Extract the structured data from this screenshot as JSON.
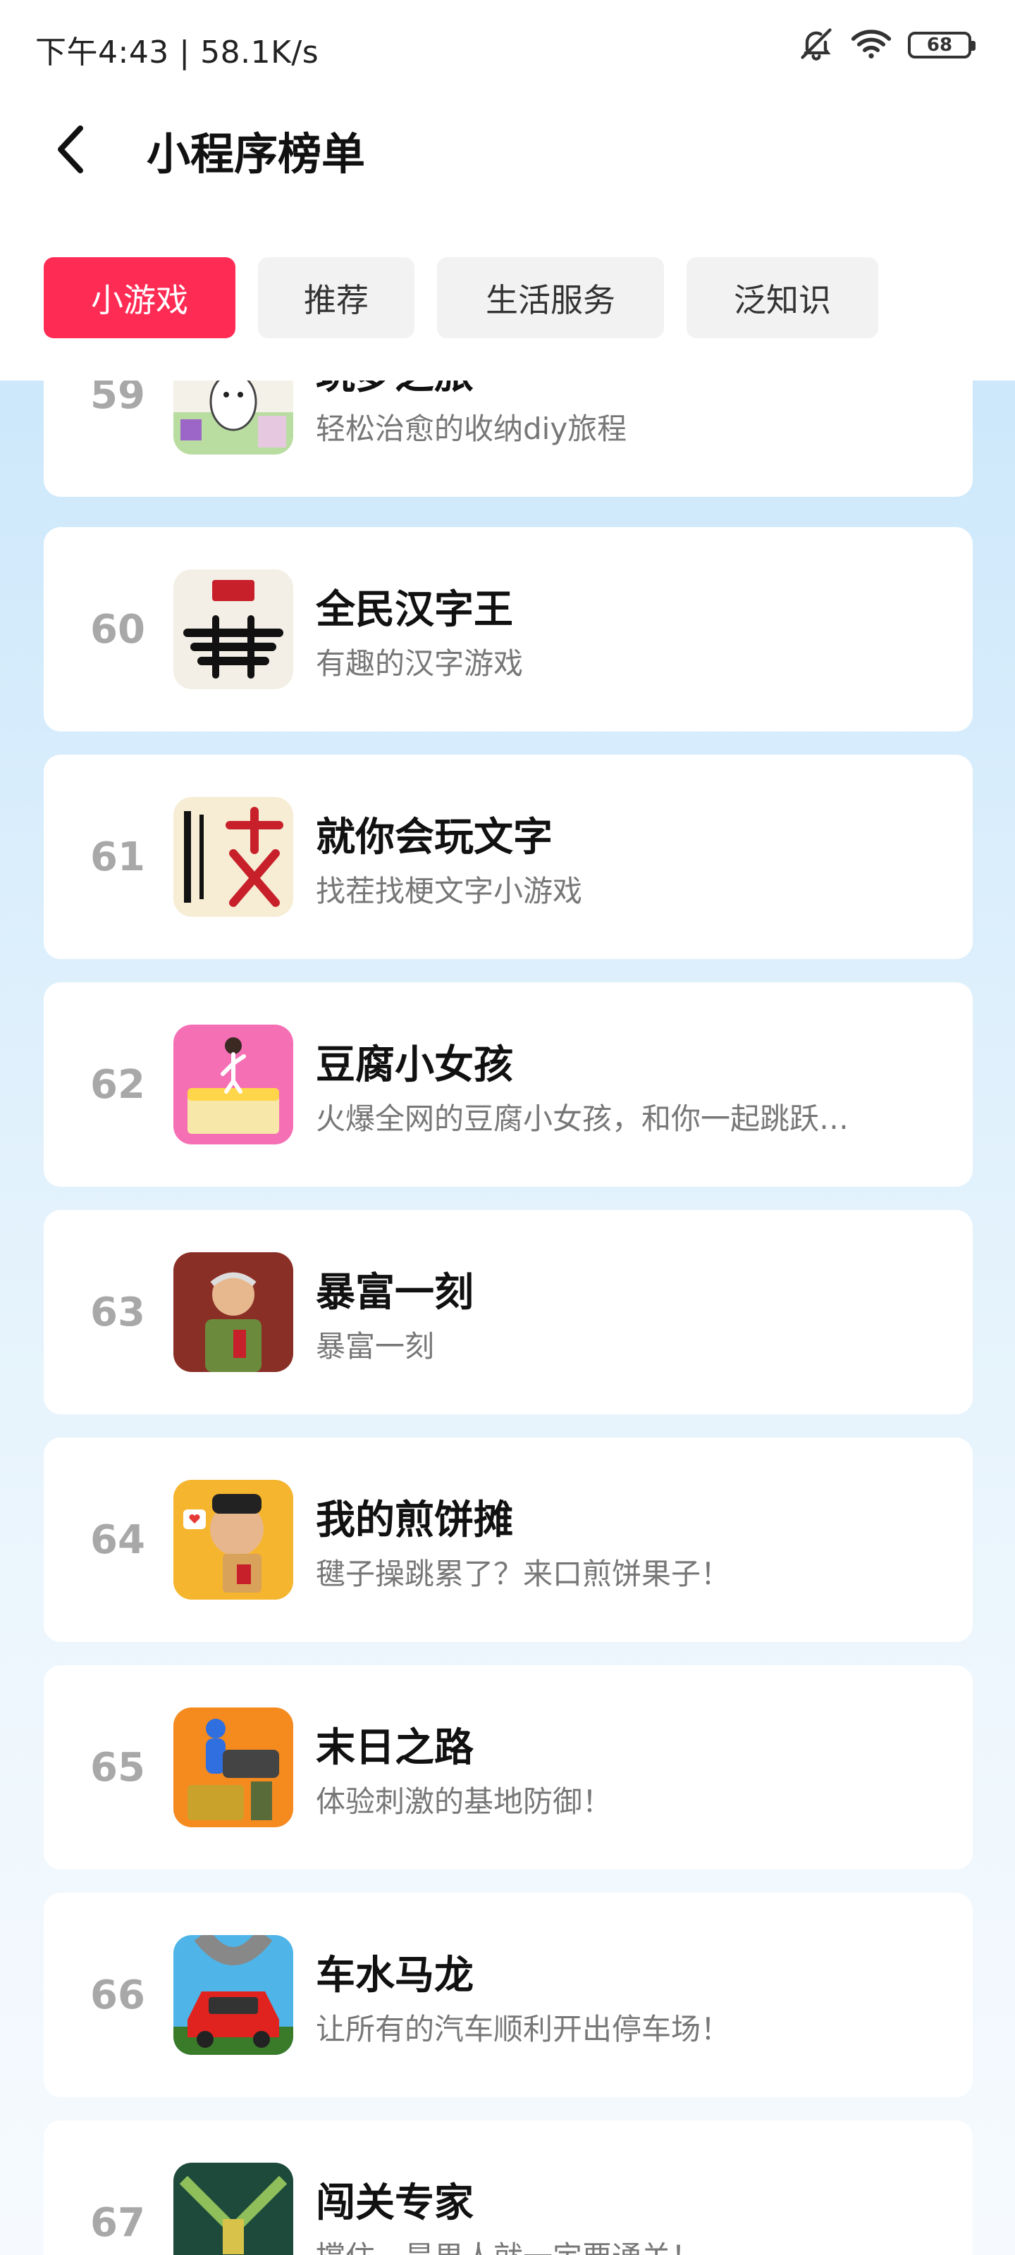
{
  "status_bar": {
    "time_speed": "下午4:43 | 58.1K/s",
    "battery": "68"
  },
  "header": {
    "title": "小程序榜单"
  },
  "tabs": [
    {
      "label": "小游戏",
      "active": true
    },
    {
      "label": "推荐",
      "active": false
    },
    {
      "label": "生活服务",
      "active": false
    },
    {
      "label": "泛知识",
      "active": false
    }
  ],
  "colors": {
    "accent": "#fe2c55",
    "rank": "#a8a8a8",
    "desc": "#777777"
  },
  "items": [
    {
      "rank": "59",
      "name": "玩梦之旅",
      "desc": "轻松治愈的收纳diy旅程",
      "icon": "cartoon-travel-icon"
    },
    {
      "rank": "60",
      "name": "全民汉字王",
      "desc": "有趣的汉字游戏",
      "icon": "hanzi-king-icon"
    },
    {
      "rank": "61",
      "name": "就你会玩文字",
      "desc": "找茬找梗文字小游戏",
      "icon": "wenzi-game-icon"
    },
    {
      "rank": "62",
      "name": "豆腐小女孩",
      "desc": "火爆全网的豆腐小女孩，和你一起跳跃…",
      "icon": "tofu-girl-icon"
    },
    {
      "rank": "63",
      "name": "暴富一刻",
      "desc": "暴富一刻",
      "icon": "rich-man-icon"
    },
    {
      "rank": "64",
      "name": "我的煎饼摊",
      "desc": "毽子操跳累了？来口煎饼果子！",
      "icon": "pancake-stall-icon"
    },
    {
      "rank": "65",
      "name": "末日之路",
      "desc": "体验刺激的基地防御！",
      "icon": "doomsday-turret-icon"
    },
    {
      "rank": "66",
      "name": "车水马龙",
      "desc": "让所有的汽车顺利开出停车场！",
      "icon": "red-car-icon"
    },
    {
      "rank": "67",
      "name": "闯关专家",
      "desc": "撑住，是男人就一定要通关！",
      "icon": "pixel-guns-icon"
    }
  ]
}
